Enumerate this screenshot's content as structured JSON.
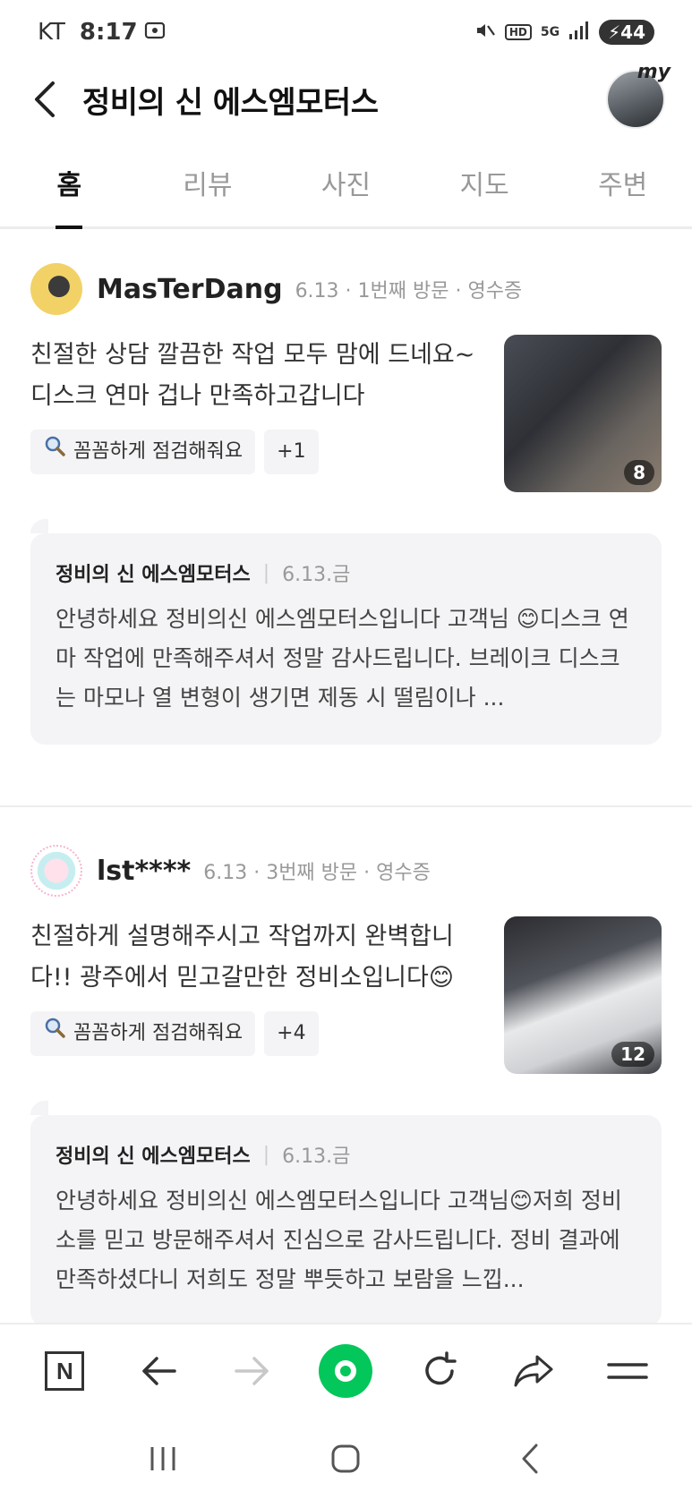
{
  "status_bar": {
    "carrier": "KT",
    "time": "8:17",
    "hd_label": "HD",
    "network": "5G",
    "battery": "44"
  },
  "header": {
    "title": "정비의 신 에스엠모터스",
    "my_badge": "my"
  },
  "tabs": [
    {
      "label": "홈",
      "active": true
    },
    {
      "label": "리뷰",
      "active": false
    },
    {
      "label": "사진",
      "active": false
    },
    {
      "label": "지도",
      "active": false
    },
    {
      "label": "주변",
      "active": false
    }
  ],
  "reviews": [
    {
      "user": "MasTerDang",
      "meta": "6.13 · 1번째 방문 · 영수증",
      "text": "친절한 상담 깔끔한 작업 모두 맘에 드네요~ 디스크 연마 겁나 만족하고갑니다",
      "keyword": "꼼꼼하게 점검해줘요",
      "extra_keywords": "+1",
      "photo_count": "8",
      "reply": {
        "name": "정비의 신 에스엠모터스",
        "date": "6.13.금",
        "text": "안녕하세요 정비의신 에스엠모터스입니다 고객님 😊디스크 연마 작업에 만족해주셔서 정말 감사드립니다. 브레이크 디스크는 마모나 열 변형이 생기면 제동 시 떨림이나 ..."
      }
    },
    {
      "user": "lst****",
      "meta": "6.13 · 3번째 방문 · 영수증",
      "text": "친절하게 설명해주시고 작업까지 완벽합니다!! 광주에서 믿고갈만한 정비소입니다😊",
      "keyword": "꼼꼼하게 점검해줘요",
      "extra_keywords": "+4",
      "photo_count": "12",
      "reply": {
        "name": "정비의 신 에스엠모터스",
        "date": "6.13.금",
        "text": "안녕하세요 정비의신 에스엠모터스입니다 고객님😊저희 정비소를 믿고 방문해주셔서 진심으로 감사드립니다. 정비 결과에 만족하셨다니 저희도 정말 뿌듯하고 보람을 느낍..."
      }
    }
  ],
  "browser_bar": {
    "logo": "N"
  }
}
